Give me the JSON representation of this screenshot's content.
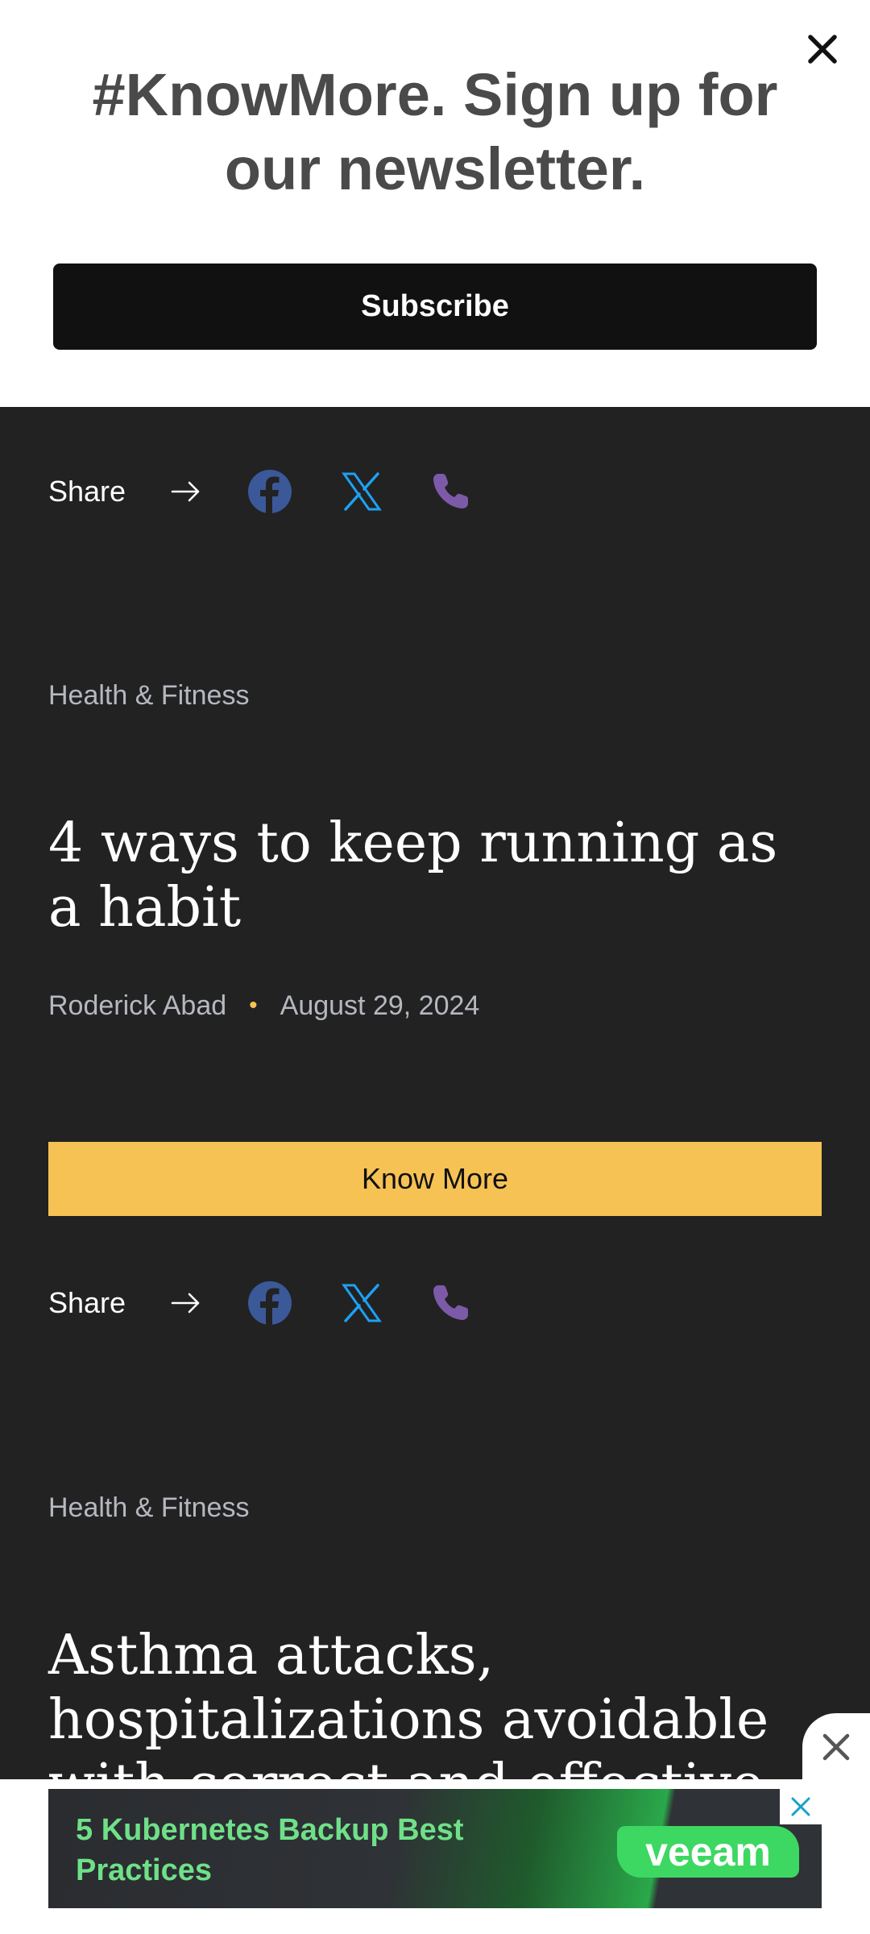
{
  "banner": {
    "title": "#KnowMore. Sign up for our newsletter.",
    "subscribe_label": "Subscribe"
  },
  "share": {
    "label": "Share"
  },
  "articles": [
    {
      "category": "Health & Fitness",
      "title": "4 ways to keep running as a habit",
      "author": "Roderick Abad",
      "date": "August 29, 2024",
      "cta_label": "Know More"
    },
    {
      "category": "Health & Fitness",
      "title": "Asthma attacks, hospitalizations avoidable with correct and effective"
    }
  ],
  "ad": {
    "text": "5 Kubernetes Backup Best Practices",
    "brand": "veeam"
  },
  "colors": {
    "page_bg": "#222223",
    "accent": "#f6c254",
    "facebook": "#3b5998",
    "x": "#1da1f2",
    "phone": "#7d5aa8"
  },
  "icons": [
    "close-icon",
    "arrow-right-icon",
    "facebook-icon",
    "x-icon",
    "phone-icon"
  ]
}
